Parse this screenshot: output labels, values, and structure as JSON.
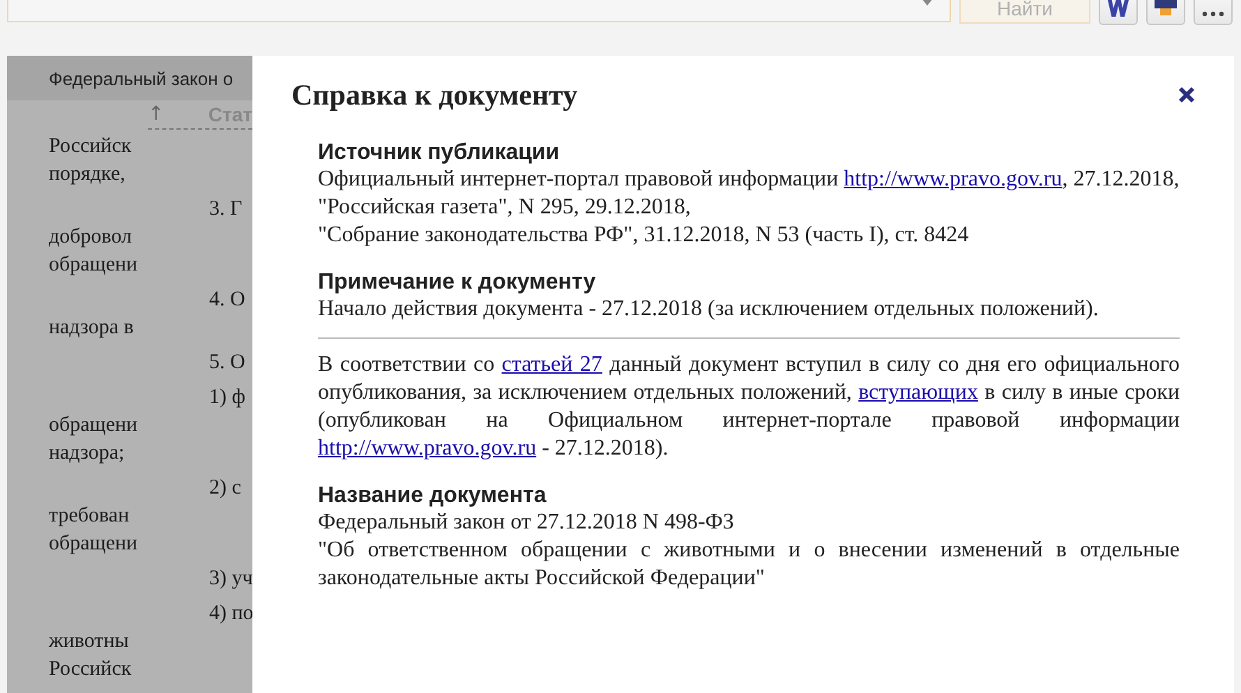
{
  "toolbar": {
    "find_button": {
      "label": "Найти",
      "disabled": true
    }
  },
  "document": {
    "title": "Федеральный закон о",
    "up_arrow": "↑",
    "article_heading": "Стат",
    "paragraphs": [
      {
        "lines": [
          "Российск",
          "порядке,"
        ]
      },
      {
        "first_line": "3. Г",
        "lines": [
          "добровол",
          "обращени"
        ]
      },
      {
        "first_line": "4. О",
        "lines": [
          "надзора в"
        ]
      },
      {
        "first_line": "5. О"
      },
      {
        "first_line": "1) ф",
        "lines": [
          "обращени",
          "надзора;"
        ]
      },
      {
        "first_line": "2) с",
        "lines": [
          "требован",
          "обращени"
        ]
      },
      {
        "first_line": "3) уч"
      },
      {
        "first_line": "4) по",
        "lines": [
          "животны",
          "Российск"
        ]
      }
    ]
  },
  "dialog": {
    "title": "Справка к документу",
    "blocks": [
      {
        "kind": "heading",
        "text": "Источник публикации"
      },
      {
        "kind": "line",
        "parts": [
          {
            "text": "Официальный интернет-портал правовой информации ",
            "link": false
          },
          {
            "text": "http://www.pravo.gov.ru",
            "link": true
          },
          {
            "text": ", 27.12.2018,",
            "link": false
          }
        ]
      },
      {
        "kind": "line",
        "parts": [
          {
            "text": "\"Российская газета\", N 295, 29.12.2018,",
            "link": false
          }
        ]
      },
      {
        "kind": "line",
        "parts": [
          {
            "text": "\"Собрание законодательства РФ\", 31.12.2018, N 53 (часть I), ст. 8424",
            "link": false
          }
        ]
      },
      {
        "kind": "heading",
        "text": "Примечание к документу"
      },
      {
        "kind": "line",
        "parts": [
          {
            "text": "Начало действия документа - 27.12.2018 (за исключением отдельных положений).",
            "link": false
          }
        ]
      },
      {
        "kind": "divider"
      },
      {
        "kind": "paragraph",
        "parts": [
          {
            "text": "В соответствии со ",
            "link": false
          },
          {
            "text": "статьей 27",
            "link": true
          },
          {
            "text": " данный документ вступил в силу со дня его официального опубликования, за исключением отдельных положений, ",
            "link": false
          },
          {
            "text": "вступающих",
            "link": true
          },
          {
            "text": " в силу в иные сроки (опубликован на Официальном интернет-портале правовой информации ",
            "link": false
          },
          {
            "text": "http://www.pravo.gov.ru",
            "link": true
          },
          {
            "text": " - 27.12.2018).",
            "link": false
          }
        ]
      },
      {
        "kind": "heading",
        "text": "Название документа"
      },
      {
        "kind": "line",
        "parts": [
          {
            "text": "Федеральный закон от 27.12.2018 N 498-ФЗ",
            "link": false
          }
        ]
      },
      {
        "kind": "paragraph",
        "parts": [
          {
            "text": "\"Об ответственном обращении с животными и о внесении изменений в отдельные законодательные акты Российской Федерации\"",
            "link": false
          }
        ]
      }
    ]
  }
}
